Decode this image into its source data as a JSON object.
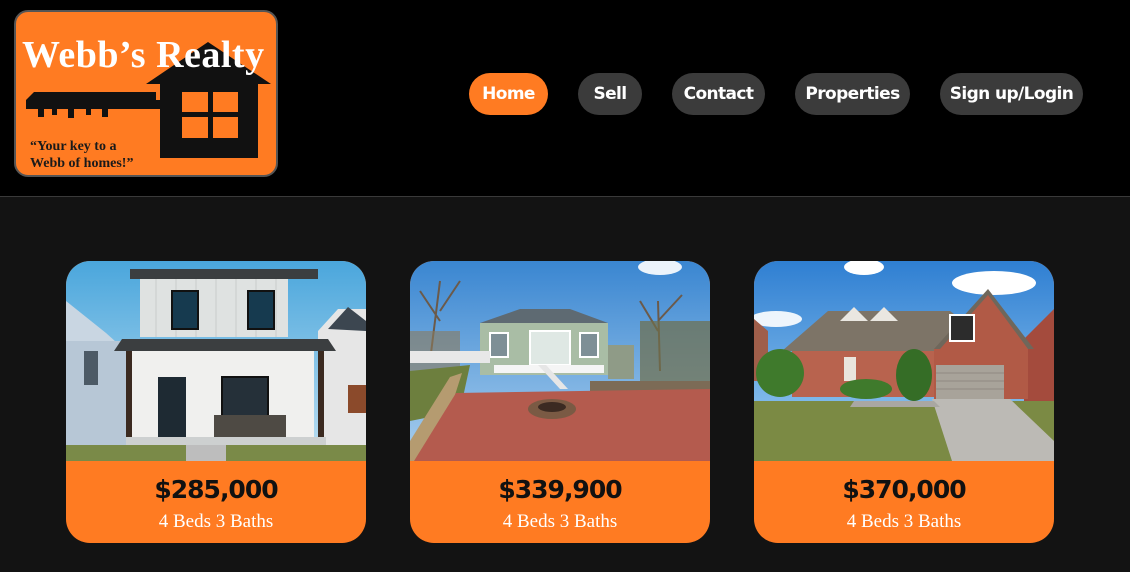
{
  "brand": {
    "title": "Webb’s Realty",
    "tagline_line1": "“Your key to a",
    "tagline_line2": "Webb of homes!”",
    "colors": {
      "accent": "#ff7b22",
      "header_bg": "#000000",
      "page_bg": "#131313",
      "nav_inactive": "#3b3b3b"
    }
  },
  "nav": {
    "items": [
      {
        "label": "Home",
        "active": true
      },
      {
        "label": "Sell",
        "active": false
      },
      {
        "label": "Contact",
        "active": false
      },
      {
        "label": "Properties",
        "active": false
      },
      {
        "label": "Sign up/Login",
        "active": false
      }
    ]
  },
  "listings": [
    {
      "price": "$285,000",
      "details": "4 Beds 3 Baths",
      "photo_icon": "white-board-and-batten-house-photo"
    },
    {
      "price": "$339,900",
      "details": "4 Beds 3 Baths",
      "photo_icon": "green-house-with-brick-patio-photo"
    },
    {
      "price": "$370,000",
      "details": "4 Beds 3 Baths",
      "photo_icon": "brick-house-with-garage-photo"
    }
  ]
}
